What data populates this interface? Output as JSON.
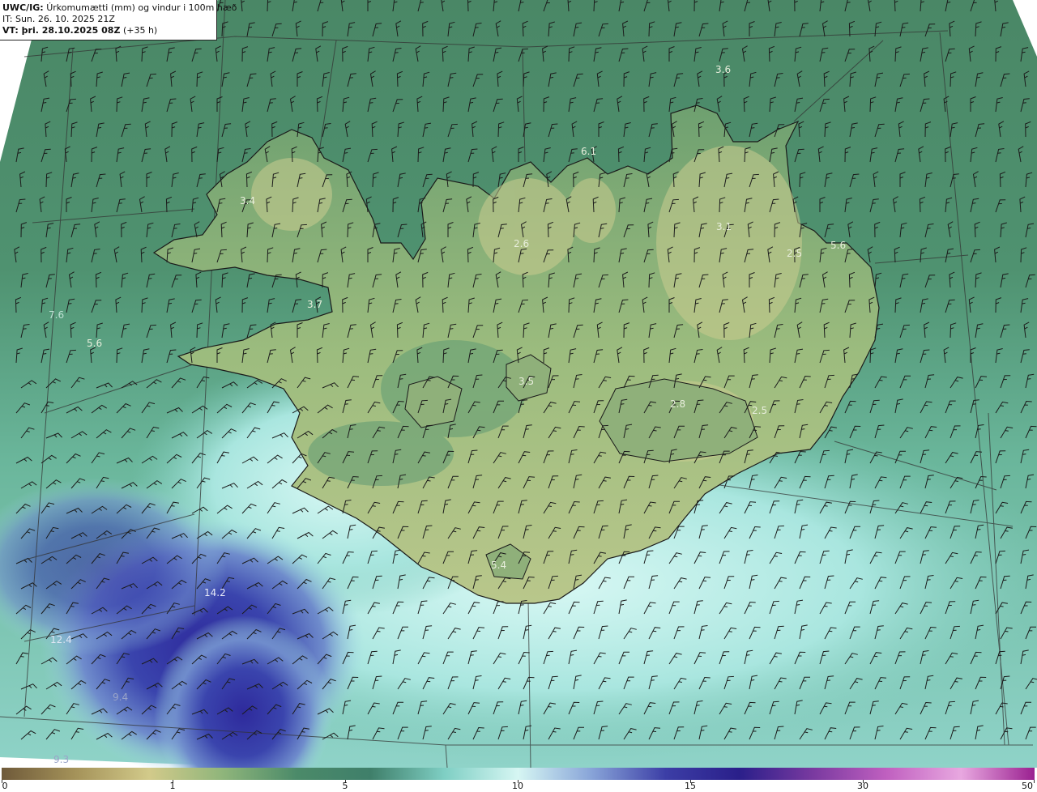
{
  "header": {
    "product": "UWC/IG:",
    "field_title": "Úrkomumætti (mm) og vindur i 100m hæð",
    "init_time": "IT: Sun. 26. 10. 2025 21Z",
    "valid_label": "VT: þri. 28.10.2025 08Z",
    "lead_time": "(+35 h)"
  },
  "value_labels": [
    "3.6",
    "6.1",
    "3.4",
    "2.6",
    "3.1",
    "2.5",
    "5.6",
    "7.6",
    "5.6",
    "3.7",
    "3.5",
    "2.8",
    "2.5",
    "5.4",
    "14.2",
    "12.4",
    "9.4",
    "9.3"
  ],
  "colorbar": {
    "ticks": [
      "0",
      "1",
      "5",
      "10",
      "15",
      "30",
      "50"
    ],
    "colors": [
      "#6f5a3a",
      "#a49259",
      "#d2ca8a",
      "#8fb57b",
      "#4b8a69",
      "#3f7f6a",
      "#7fcfc4",
      "#d6f6f3",
      "#88a4d8",
      "#3c3ea6",
      "#2a1f8a",
      "#7a3aa0",
      "#c060c0",
      "#e8a8e0",
      "#9a2090"
    ]
  },
  "colors": {
    "ocean_north": "#4f8c69",
    "ocean_south_light": "#bff1ec",
    "ocean_southwest_deep": "#3335a3",
    "land": "#8fb37a",
    "land_high": "#c3c98e"
  }
}
